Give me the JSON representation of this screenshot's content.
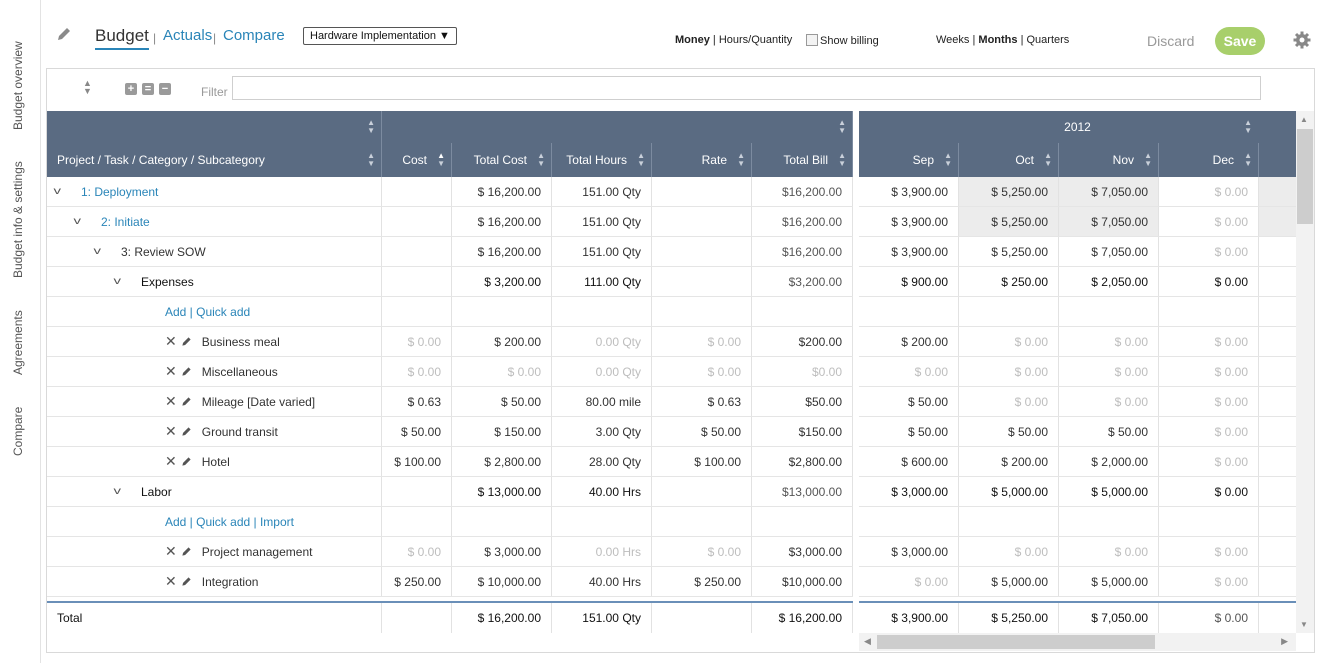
{
  "side_tabs": [
    "Budget overview",
    "Budget info & settings",
    "Agreements",
    "Compare"
  ],
  "nav": {
    "budget": "Budget",
    "actuals": "Actuals",
    "compare": "Compare",
    "sep": "|"
  },
  "project_select": "Hardware Implementation",
  "units": {
    "money": "Money",
    "hours": "Hours/Quantity"
  },
  "show_billing": "Show billing",
  "periods": {
    "weeks": "Weeks",
    "months": "Months",
    "quarters": "Quarters"
  },
  "discard": "Discard",
  "save": "Save",
  "filter_label": "Filter",
  "year_label": "2012",
  "columns": [
    "Project / Task / Category / Subcategory",
    "Cost",
    "Total Cost",
    "Total Hours",
    "Rate",
    "Total Bill"
  ],
  "months": [
    "Sep",
    "Oct",
    "Nov",
    "Dec"
  ],
  "rows": [
    {
      "name": "1: Deployment",
      "cost": "",
      "total_cost": "$ 16,200.00",
      "total_hours": "151.00 Qty",
      "rate": "",
      "total_bill": "$16,200.00",
      "m": [
        "$ 3,900.00",
        "$ 5,250.00",
        "$ 7,050.00",
        "$ 0.00"
      ]
    },
    {
      "name": "2: Initiate",
      "cost": "",
      "total_cost": "$ 16,200.00",
      "total_hours": "151.00 Qty",
      "rate": "",
      "total_bill": "$16,200.00",
      "m": [
        "$ 3,900.00",
        "$ 5,250.00",
        "$ 7,050.00",
        "$ 0.00"
      ]
    },
    {
      "name": "3: Review SOW",
      "cost": "",
      "total_cost": "$ 16,200.00",
      "total_hours": "151.00 Qty",
      "rate": "",
      "total_bill": "$16,200.00",
      "m": [
        "$ 3,900.00",
        "$ 5,250.00",
        "$ 7,050.00",
        "$ 0.00"
      ]
    },
    {
      "name": "Expenses",
      "cost": "",
      "total_cost": "$ 3,200.00",
      "total_hours": "111.00 Qty",
      "rate": "",
      "total_bill": "$3,200.00",
      "m": [
        "$ 900.00",
        "$ 250.00",
        "$ 2,050.00",
        "$ 0.00"
      ]
    },
    {
      "name": "Add | Quick add"
    },
    {
      "name": "Business meal",
      "cost": "$ 0.00",
      "total_cost": "$ 200.00",
      "total_hours": "0.00 Qty",
      "rate": "$ 0.00",
      "total_bill": "$200.00",
      "m": [
        "$ 200.00",
        "$ 0.00",
        "$ 0.00",
        "$ 0.00"
      ]
    },
    {
      "name": "Miscellaneous",
      "cost": "$ 0.00",
      "total_cost": "$ 0.00",
      "total_hours": "0.00 Qty",
      "rate": "$ 0.00",
      "total_bill": "$0.00",
      "m": [
        "$ 0.00",
        "$ 0.00",
        "$ 0.00",
        "$ 0.00"
      ]
    },
    {
      "name": "Mileage [Date varied]",
      "cost": "$ 0.63",
      "total_cost": "$ 50.00",
      "total_hours": "80.00 mile",
      "rate": "$ 0.63",
      "total_bill": "$50.00",
      "m": [
        "$ 50.00",
        "$ 0.00",
        "$ 0.00",
        "$ 0.00"
      ]
    },
    {
      "name": "Ground transit",
      "cost": "$ 50.00",
      "total_cost": "$ 150.00",
      "total_hours": "3.00 Qty",
      "rate": "$ 50.00",
      "total_bill": "$150.00",
      "m": [
        "$ 50.00",
        "$ 50.00",
        "$ 50.00",
        "$ 0.00"
      ]
    },
    {
      "name": "Hotel",
      "cost": "$ 100.00",
      "total_cost": "$ 2,800.00",
      "total_hours": "28.00 Qty",
      "rate": "$ 100.00",
      "total_bill": "$2,800.00",
      "m": [
        "$ 600.00",
        "$ 200.00",
        "$ 2,000.00",
        "$ 0.00"
      ]
    },
    {
      "name": "Labor",
      "cost": "",
      "total_cost": "$ 13,000.00",
      "total_hours": "40.00 Hrs",
      "rate": "",
      "total_bill": "$13,000.00",
      "m": [
        "$ 3,000.00",
        "$ 5,000.00",
        "$ 5,000.00",
        "$ 0.00"
      ]
    },
    {
      "name": "Add | Quick add | Import"
    },
    {
      "name": "Project management",
      "cost": "$ 0.00",
      "total_cost": "$ 3,000.00",
      "total_hours": "0.00 Hrs",
      "rate": "$ 0.00",
      "total_bill": "$3,000.00",
      "m": [
        "$ 3,000.00",
        "$ 0.00",
        "$ 0.00",
        "$ 0.00"
      ]
    },
    {
      "name": "Integration",
      "cost": "$ 250.00",
      "total_cost": "$ 10,000.00",
      "total_hours": "40.00 Hrs",
      "rate": "$ 250.00",
      "total_bill": "$10,000.00",
      "m": [
        "$ 0.00",
        "$ 5,000.00",
        "$ 5,000.00",
        "$ 0.00"
      ]
    }
  ],
  "total": {
    "name": "Total",
    "total_cost": "$ 16,200.00",
    "total_hours": "151.00 Qty",
    "total_bill": "$ 16,200.00",
    "m": [
      "$ 3,900.00",
      "$ 5,250.00",
      "$ 7,050.00",
      "$ 0.00"
    ]
  },
  "colors": {
    "header": "#5a6b82",
    "link": "#2a85b8",
    "save": "#a8cf6b"
  }
}
